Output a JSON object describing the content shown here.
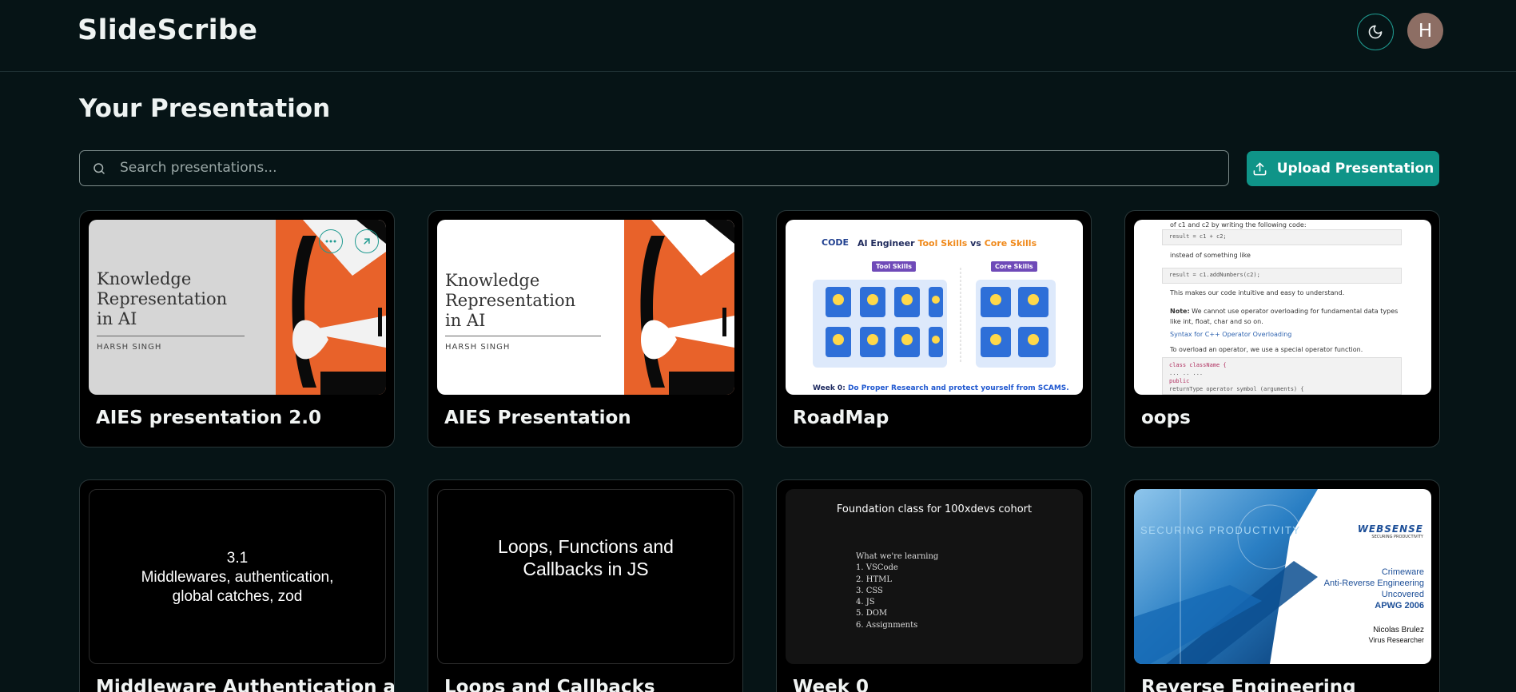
{
  "app": {
    "brand": "SlideScribe",
    "avatar_initial": "H",
    "theme_toggle_icon": "moon-icon"
  },
  "page": {
    "title": "Your Presentation"
  },
  "search": {
    "placeholder": "Search presentations...",
    "value": ""
  },
  "toolbar": {
    "upload_label": "Upload Presentation"
  },
  "colors": {
    "accent": "#0f9488",
    "background": "#061416",
    "card": "#000000"
  },
  "presentations": [
    {
      "title": "AIES presentation 2.0",
      "slide": {
        "heading_lines": [
          "Knowledge",
          "Representation",
          "in AI"
        ],
        "author": "HARSH SINGH"
      }
    },
    {
      "title": "AIES Presentation",
      "slide": {
        "heading_lines": [
          "Knowledge",
          "Representation",
          "in AI"
        ],
        "author": "HARSH SINGH"
      }
    },
    {
      "title": "RoadMap",
      "slide": {
        "logo": "CODE",
        "heading_prefix": "AI Engineer ",
        "heading_tool": "Tool Skills",
        "heading_mid": " vs ",
        "heading_core": "Core Skills",
        "tool_label": "Tool Skills",
        "core_label": "Core Skills",
        "footer_prefix": "Week 0: ",
        "footer_rest": "Do Proper Research and protect yourself from SCAMS."
      }
    },
    {
      "title": "oops",
      "slide": {
        "line1": "of c1 and c2 by writing the following code:",
        "code1": "result = c1 + c2;",
        "line2": "instead of something like",
        "code2": "result = c1.addNumbers(c2);",
        "line3": "This makes our code intuitive and easy to understand.",
        "note_label": "Note:",
        "note_text": " We cannot use operator overloading for fundamental data types",
        "note_text2": "like int, float, char and so on.",
        "syntax_link": "Syntax for C++ Operator Overloading",
        "line4": "To overload an operator, we use a special operator function.",
        "code3a": "class className {",
        "code3b": "    ... .. ...",
        "code3c": "    public",
        "code3d": "       returnType operator symbol (arguments) {"
      }
    },
    {
      "title": "Middleware Authentication and",
      "slide": {
        "lines": [
          "3.1",
          "Middlewares, authentication,",
          "global catches, zod"
        ]
      }
    },
    {
      "title": "Loops and Callbacks",
      "slide": {
        "lines": [
          "Loops, Functions and",
          "Callbacks in JS"
        ]
      }
    },
    {
      "title": "Week 0",
      "slide": {
        "heading": "Foundation class for 100xdevs cohort",
        "list_title": "What we're learning",
        "items": [
          "1. VSCode",
          "2. HTML",
          "3. CSS",
          "4. JS",
          "5. DOM",
          "6. Assignments"
        ]
      }
    },
    {
      "title": "Reverse Engineering",
      "slide": {
        "tagline": "SECURING PRODUCTIVITY",
        "logo": "WEBSENSE",
        "logo_sub": "SECURING PRODUCTIVITY",
        "lines": [
          "Crimeware",
          "Anti-Reverse Engineering",
          "Uncovered"
        ],
        "event": "APWG 2006",
        "presenter": "Nicolas Brulez",
        "role": "Virus Researcher"
      }
    }
  ]
}
